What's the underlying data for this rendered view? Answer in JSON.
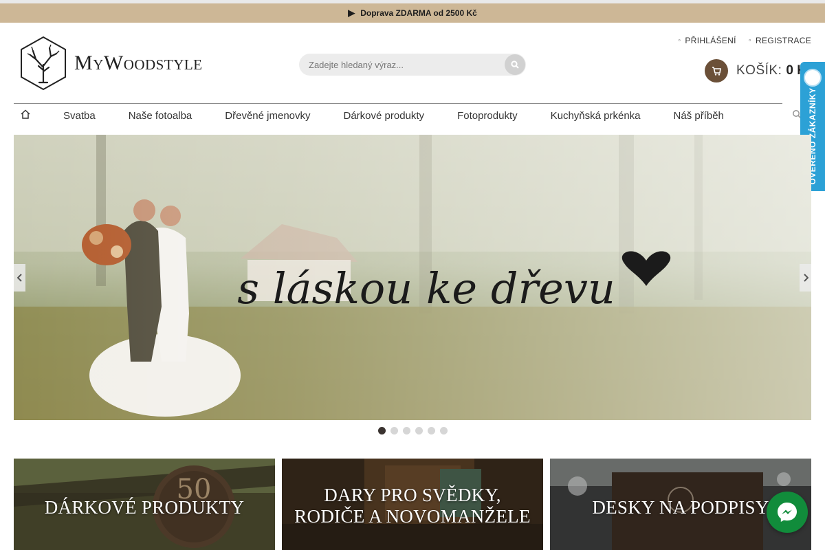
{
  "promo": {
    "icon": "truck-icon",
    "text": "Doprava ZDARMA od 2500 Kč",
    "background": "#cdb796"
  },
  "logo": {
    "icon": "tree-logo-icon",
    "text_first": "M",
    "text_first_rest": "Y",
    "text_second": "W",
    "text_second_rest": "OODSTYLE"
  },
  "search": {
    "placeholder": "Zadejte hledaný výraz...",
    "icon": "search-icon"
  },
  "account": {
    "login": "PŘIHLÁŠENÍ",
    "register": "REGISTRACE"
  },
  "cart": {
    "label": "KOŠÍK:",
    "value": "0 K",
    "icon": "cart-icon",
    "color": "#6b5038"
  },
  "nav": {
    "home_icon": "home-icon",
    "items": [
      {
        "label": "Svatba"
      },
      {
        "label": "Naše fotoalba"
      },
      {
        "label": "Dřevěné jmenovky"
      },
      {
        "label": "Dárkové produkty"
      },
      {
        "label": "Fotoprodukty"
      },
      {
        "label": "Kuchyňská prkénka"
      },
      {
        "label": "Náš příběh"
      }
    ],
    "search_icon": "search-icon"
  },
  "badge": {
    "text": "OVĚŘENO ZÁKAZNÍKY",
    "color": "#2ca1d6"
  },
  "hero": {
    "tagline": "s láskou ke dřevu",
    "slide_count": 6,
    "active_slide": 1,
    "prev_icon": "chevron-left-icon",
    "next_icon": "chevron-right-icon"
  },
  "categories": [
    {
      "title": "DÁRKOVÉ PRODUKTY"
    },
    {
      "title_line1": "DARY PRO SVĚDKY,",
      "title_line2": "RODIČE A NOVOMANŽELE"
    },
    {
      "title": "DESKY NA PODPISY"
    }
  ],
  "messenger": {
    "icon": "messenger-icon",
    "color": "#118c3b"
  }
}
